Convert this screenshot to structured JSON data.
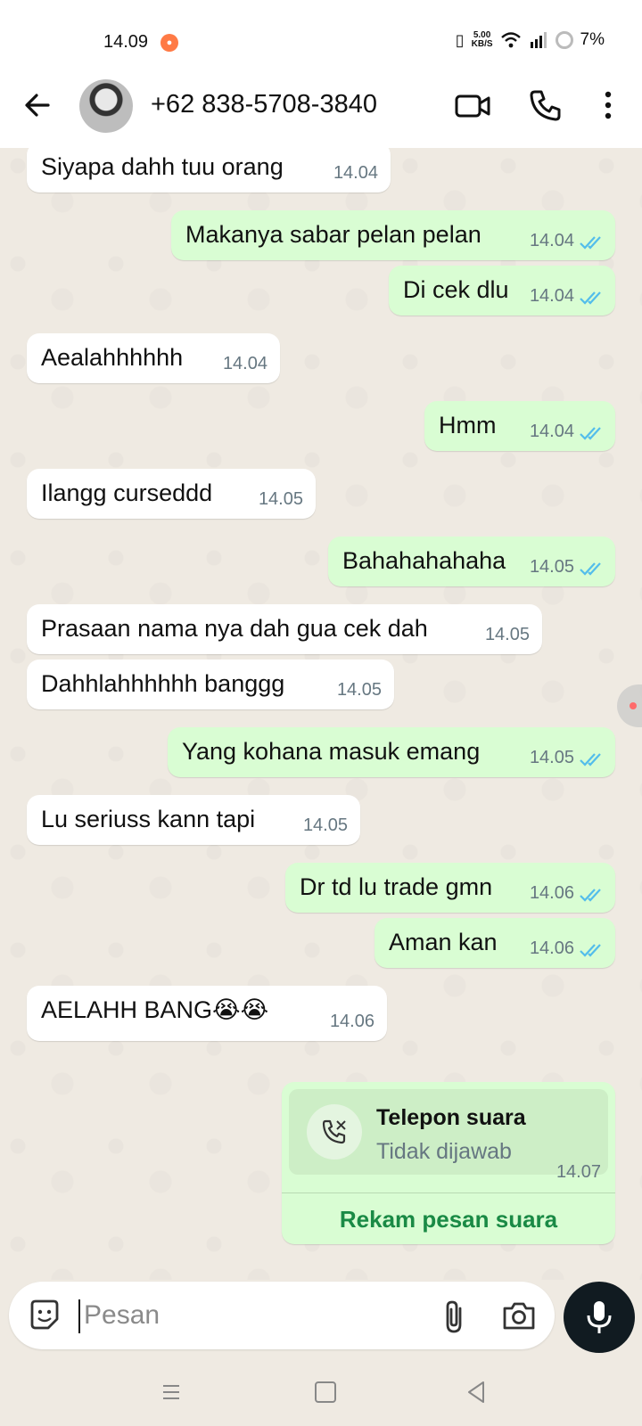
{
  "status_bar": {
    "time": "14.09",
    "net_speed_value": "5.00",
    "net_speed_unit": "KB/S",
    "battery": "7%"
  },
  "header": {
    "contact": "+62 838-5708-3840"
  },
  "messages": [
    {
      "dir": "in",
      "text": "Siyapa dahh tuu orang",
      "time": "14.04"
    },
    {
      "dir": "out",
      "text": "Makanya sabar pelan pelan",
      "time": "14.04",
      "status": "read"
    },
    {
      "dir": "out",
      "text": "Di cek dlu",
      "time": "14.04",
      "status": "read"
    },
    {
      "dir": "in",
      "text": "Aealahhhhhh",
      "time": "14.04"
    },
    {
      "dir": "out",
      "text": "Hmm",
      "time": "14.04",
      "status": "read"
    },
    {
      "dir": "in",
      "text": "Ilangg curseddd",
      "time": "14.05"
    },
    {
      "dir": "out",
      "text": "Bahahahahaha",
      "time": "14.05",
      "status": "read"
    },
    {
      "dir": "in",
      "text": "Prasaan nama nya dah gua cek dah",
      "time": "14.05"
    },
    {
      "dir": "in",
      "text": "Dahhlahhhhhh banggg",
      "time": "14.05"
    },
    {
      "dir": "out",
      "text": "Yang kohana masuk emang",
      "time": "14.05",
      "status": "read"
    },
    {
      "dir": "in",
      "text": "Lu seriuss kann tapi",
      "time": "14.05"
    },
    {
      "dir": "out",
      "text": "Dr td lu trade gmn",
      "time": "14.06",
      "status": "read"
    },
    {
      "dir": "out",
      "text": "Aman kan",
      "time": "14.06",
      "status": "read"
    },
    {
      "dir": "in",
      "text": "AELAHH BANG😭😭",
      "time": "14.06"
    }
  ],
  "call_card": {
    "title": "Telepon suara",
    "subtitle": "Tidak dijawab",
    "time": "14.07",
    "action": "Rekam pesan suara"
  },
  "composer": {
    "placeholder": "Pesan"
  },
  "colors": {
    "chat_bg": "#efeae2",
    "bubble_out": "#d9fdd3",
    "bubble_in": "#ffffff",
    "read_tick": "#53bdeb",
    "accent_green": "#1a8a45"
  },
  "icons": [
    "back-arrow-icon",
    "video-call-icon",
    "phone-icon",
    "more-vert-icon",
    "sticker-icon",
    "attach-icon",
    "camera-icon",
    "mic-icon",
    "missed-call-icon"
  ]
}
